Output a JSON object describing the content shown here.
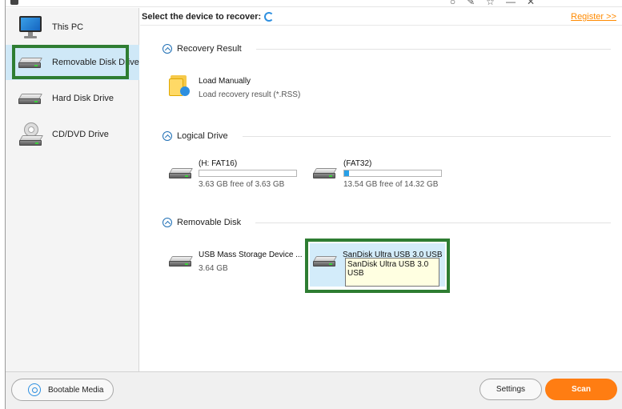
{
  "sidebar": {
    "items": [
      {
        "label": "This PC",
        "icon": "monitor-icon"
      },
      {
        "label": "Removable Disk Drive",
        "icon": "removable-drive-icon"
      },
      {
        "label": "Hard Disk Drive",
        "icon": "hard-drive-icon"
      },
      {
        "label": "CD/DVD Drive",
        "icon": "cd-dvd-icon"
      }
    ],
    "active_index": 1
  },
  "main": {
    "select_title": "Select the device to recover:",
    "register_link": "Register >>",
    "recovery": {
      "section_label": "Recovery Result",
      "load_title": "Load Manually",
      "load_sub": "Load recovery result (*.RSS)"
    },
    "logical": {
      "section_label": "Logical Drive",
      "drives": [
        {
          "name": "(H: FAT16)",
          "free": "3.63 GB free of 3.63 GB",
          "used_fraction": 0.0
        },
        {
          "name": "(FAT32)",
          "free": "13.54 GB free of 14.32 GB",
          "used_fraction": 0.05
        }
      ]
    },
    "removable": {
      "section_label": "Removable Disk",
      "disks": [
        {
          "name": "USB Mass Storage Device ...",
          "size": "3.64 GB"
        },
        {
          "name": "SanDisk Ultra USB 3.0 USB"
        }
      ],
      "tooltip": "SanDisk Ultra USB 3.0 USB"
    }
  },
  "footer": {
    "bootable_label": "Bootable Media",
    "settings_label": "Settings",
    "scan_label": "Scan"
  },
  "colors": {
    "accent_orange": "#ff7d12",
    "highlight_green": "#2e7d32",
    "selection_blue": "#d3ecfa",
    "progress_blue": "#27a0e8"
  }
}
